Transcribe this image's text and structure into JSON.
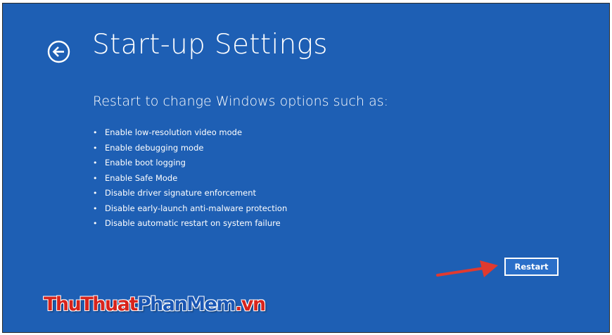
{
  "page": {
    "title": "Start-up Settings",
    "back_icon": "circle-arrow-left-icon"
  },
  "content": {
    "subtitle": "Restart to change Windows options such as:",
    "bullet": "•",
    "options": [
      "Enable low-resolution video mode",
      "Enable debugging mode",
      "Enable boot logging",
      "Enable Safe Mode",
      "Disable driver signature enforcement",
      "Disable early-launch anti-malware protection",
      "Disable automatic restart on system failure"
    ]
  },
  "actions": {
    "restart_label": "Restart"
  },
  "annotation": {
    "arrow_icon": "red-arrow-right-icon",
    "color": "#e03a2f"
  },
  "watermark": {
    "part1": "ThuThuat",
    "part2": "PhanMem",
    "part3": ".vn"
  },
  "colors": {
    "background": "#1e5fb4",
    "text": "#ffffff",
    "watermark_red": "#d8241c",
    "watermark_blue": "#1a56b4"
  }
}
